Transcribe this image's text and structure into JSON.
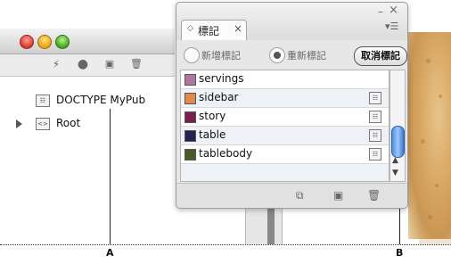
{
  "structure_window": {
    "toolbar_icons": [
      "lightning-icon",
      "dot-icon",
      "new-element-icon",
      "trash-icon"
    ],
    "items": [
      {
        "label": "DOCTYPE MyPub",
        "icon": "doctype-icon",
        "expanded": false
      },
      {
        "label": "Root",
        "icon": "xml-element-icon",
        "expanded": false
      }
    ]
  },
  "tags_panel": {
    "tab_label": "標記",
    "tab_close": "×",
    "radio_new": "新增標記",
    "radio_retag": "重新標記",
    "retag_selected": true,
    "untag_button": "取消標記",
    "tags": [
      {
        "name": "servings",
        "color": "#b0779e",
        "has_icon": false
      },
      {
        "name": "sidebar",
        "color": "#e08a4f",
        "has_icon": true
      },
      {
        "name": "story",
        "color": "#7a1f4d",
        "has_icon": true
      },
      {
        "name": "table",
        "color": "#23214f",
        "has_icon": true
      },
      {
        "name": "tablebody",
        "color": "#4a5a2a",
        "has_icon": true
      }
    ],
    "bottom_icons": [
      "map-tags-icon",
      "new-tag-icon",
      "trash-icon"
    ]
  },
  "callouts": {
    "a": "A",
    "b": "B"
  }
}
